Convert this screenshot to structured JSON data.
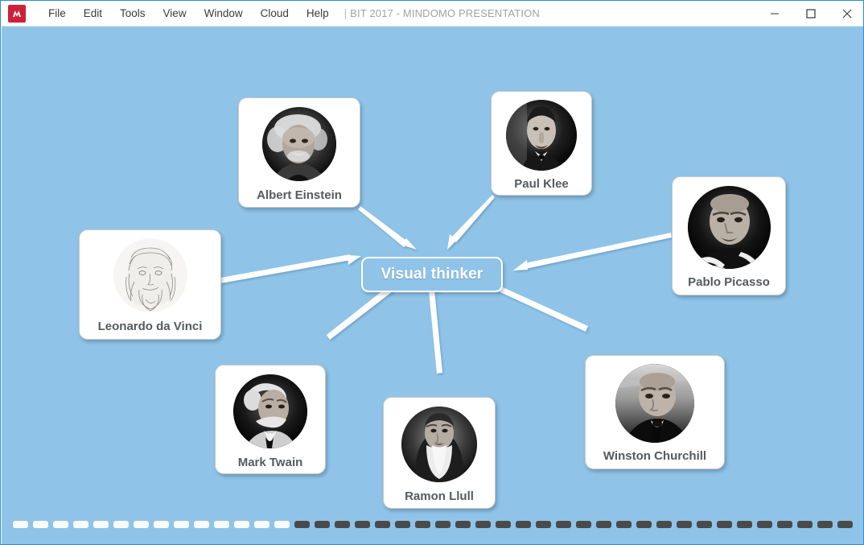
{
  "window": {
    "app_icon": "mindomo-logo-icon",
    "document_title": "BIT 2017 - MINDOMO PRESENTATION",
    "title_separator": "|",
    "menu": [
      {
        "label": "File"
      },
      {
        "label": "Edit"
      },
      {
        "label": "Tools"
      },
      {
        "label": "View"
      },
      {
        "label": "Window"
      },
      {
        "label": "Cloud"
      },
      {
        "label": "Help"
      }
    ],
    "controls": [
      {
        "name": "minimize",
        "icon": "minimize-icon"
      },
      {
        "name": "maximize",
        "icon": "maximize-icon"
      },
      {
        "name": "close",
        "icon": "close-icon"
      }
    ]
  },
  "canvas": {
    "background_color": "#8fc4e8",
    "central_node": {
      "label": "Visual thinker",
      "text_color": "#ffffff",
      "border_color": "#ffffff"
    },
    "nodes": [
      {
        "id": "albert-einstein",
        "label": "Albert Einstein",
        "portrait": "portrait-albert-einstein"
      },
      {
        "id": "paul-klee",
        "label": "Paul Klee",
        "portrait": "portrait-paul-klee"
      },
      {
        "id": "pablo-picasso",
        "label": "Pablo Picasso",
        "portrait": "portrait-pablo-picasso"
      },
      {
        "id": "leonardo-da-vinci",
        "label": "Leonardo da Vinci",
        "portrait": "portrait-leonardo-da-vinci"
      },
      {
        "id": "mark-twain",
        "label": "Mark Twain",
        "portrait": "portrait-mark-twain"
      },
      {
        "id": "ramon-llull",
        "label": "Ramon Llull",
        "portrait": "portrait-ramon-llull"
      },
      {
        "id": "winston-churchill",
        "label": "Winston Churchill",
        "portrait": "portrait-winston-churchill"
      }
    ],
    "connectors": [
      {
        "from": "albert-einstein",
        "to": "central-node",
        "color": "#ffffff"
      },
      {
        "from": "paul-klee",
        "to": "central-node",
        "color": "#ffffff"
      },
      {
        "from": "pablo-picasso",
        "to": "central-node",
        "color": "#ffffff"
      },
      {
        "from": "leonardo-da-vinci",
        "to": "central-node",
        "color": "#ffffff"
      },
      {
        "from": "mark-twain",
        "to": "central-node",
        "color": "#ffffff"
      },
      {
        "from": "ramon-llull",
        "to": "central-node",
        "color": "#ffffff"
      },
      {
        "from": "winston-churchill",
        "to": "central-node",
        "color": "#ffffff"
      }
    ]
  },
  "progress": {
    "total_steps": 42,
    "completed_steps": 14,
    "done_color": "#fbfbfb",
    "remaining_color": "#4a4a4a"
  }
}
